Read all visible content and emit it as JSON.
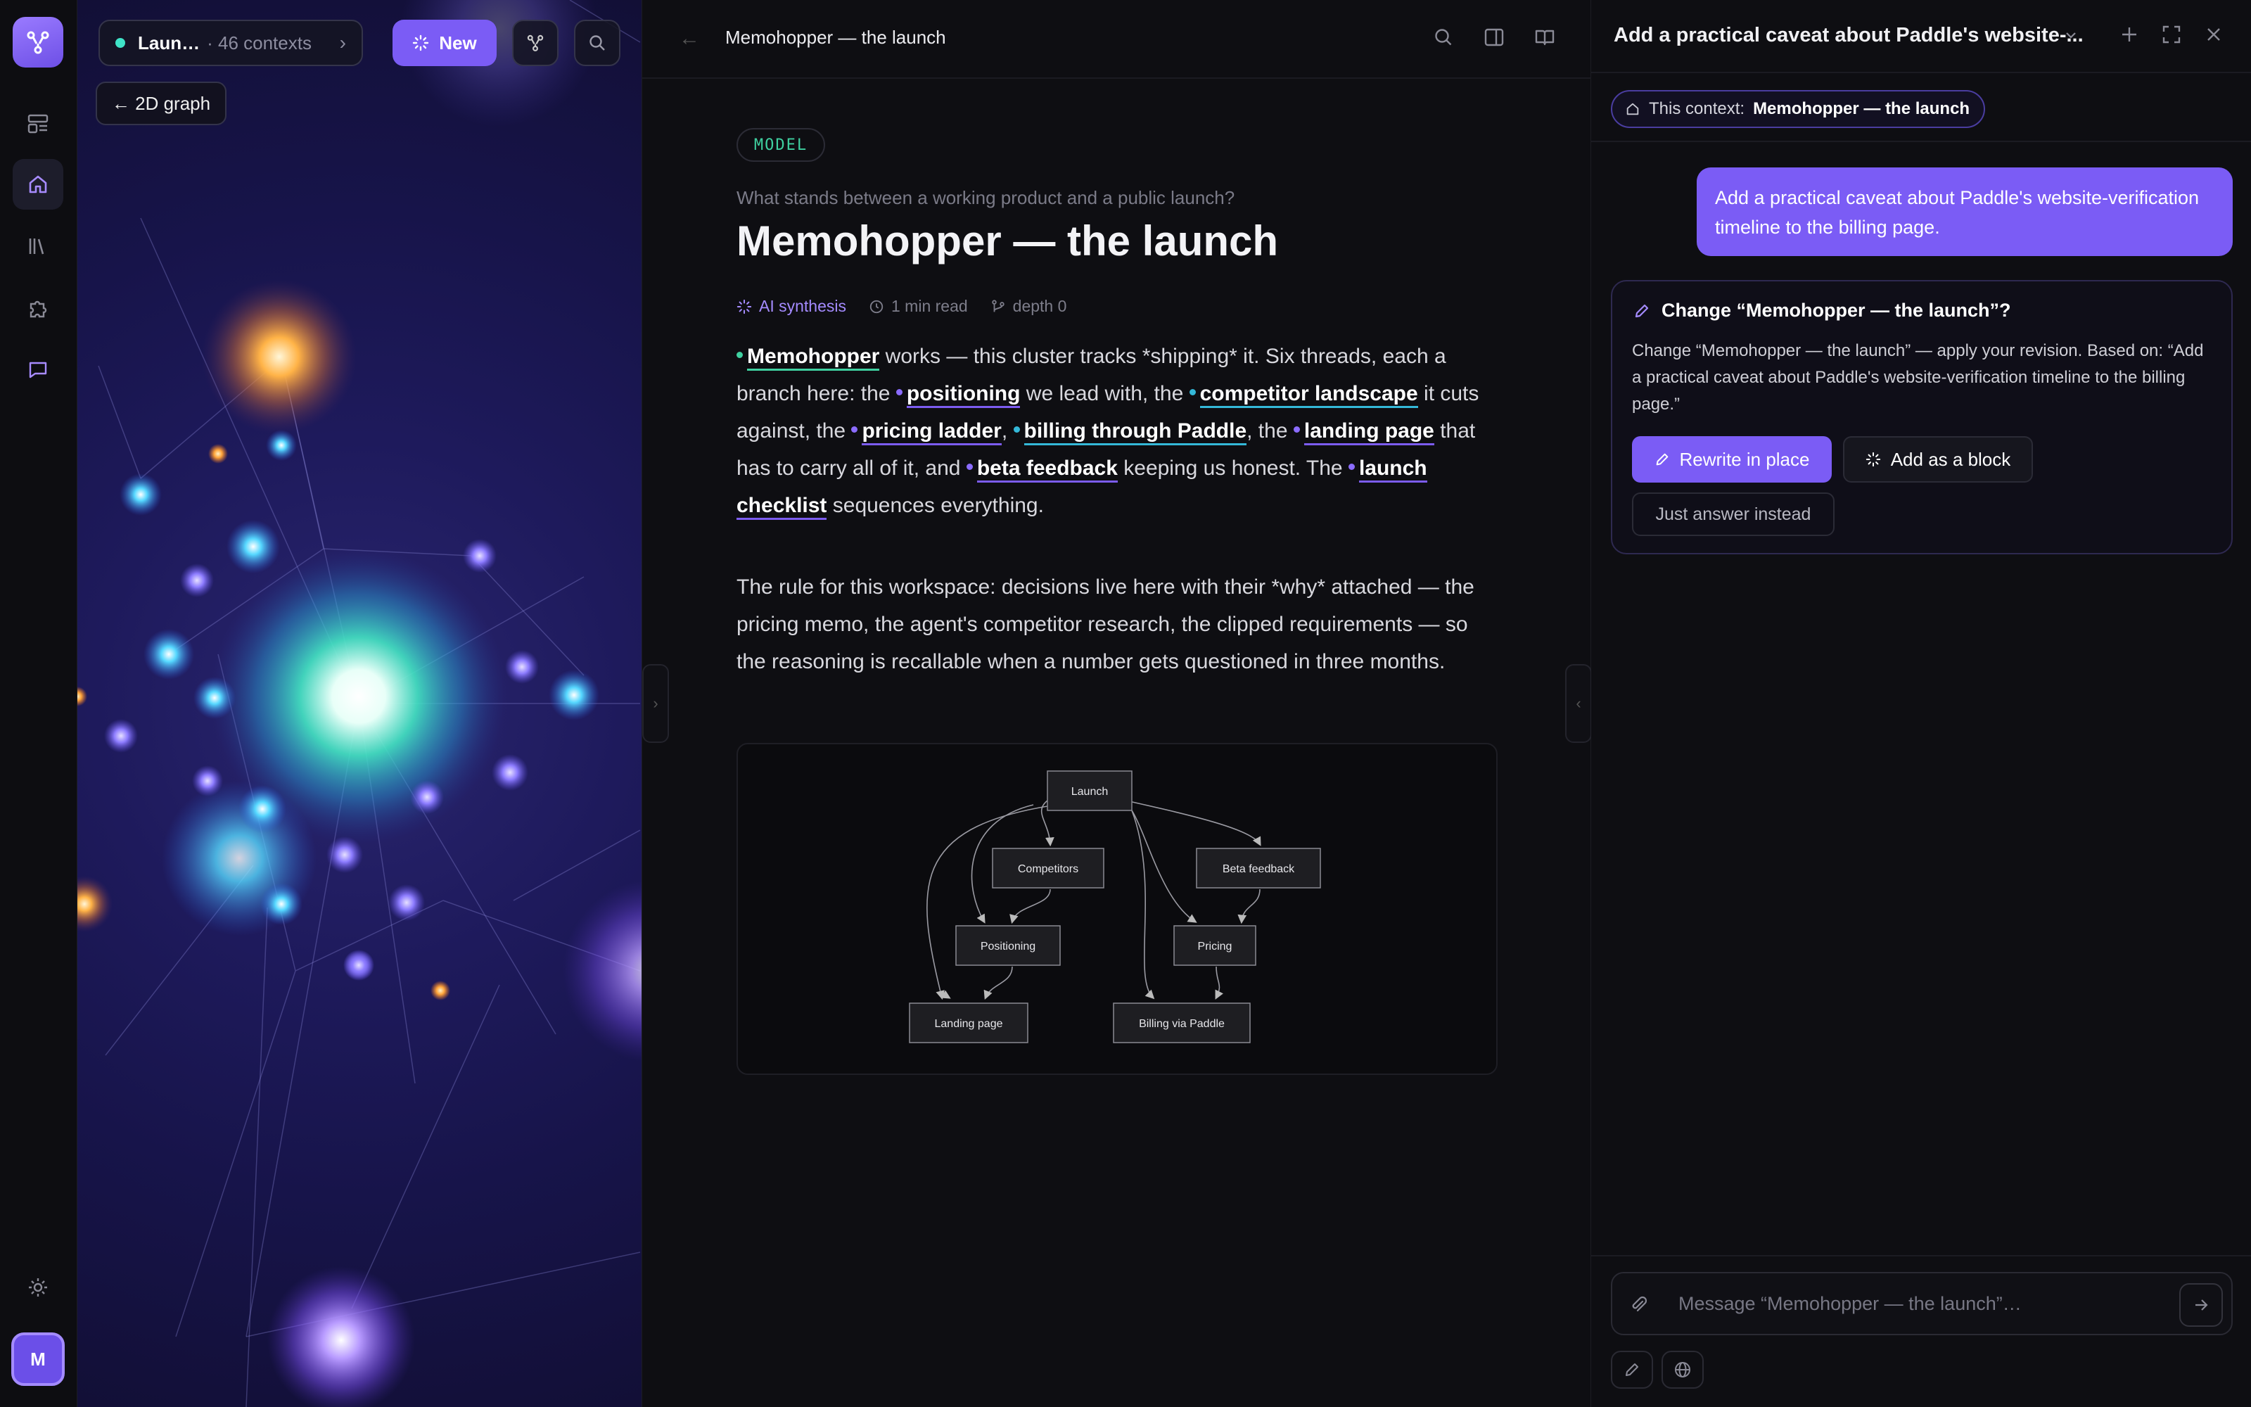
{
  "rail": {
    "avatar_letter": "M"
  },
  "graph": {
    "context_name": "Laun…",
    "context_count": "· 46 contexts",
    "new_label": "New",
    "back_label": "← 2D graph"
  },
  "doc": {
    "top_title": "Memohopper — the launch",
    "badge": "MODEL",
    "subtitle": "What stands between a working product and a public launch?",
    "title": "Memohopper — the launch",
    "meta": {
      "synthesis": "AI synthesis",
      "read": "1 min read",
      "depth": "depth 0"
    },
    "para1": {
      "l_memohopper": "Memohopper",
      "t1": " works — this cluster tracks *shipping* it. Six threads, each a branch here: the ",
      "l_positioning": "positioning",
      "t2": " we lead with, the ",
      "l_competitor": "competitor landscape",
      "t3": " it cuts against, the ",
      "l_pricing": "pricing ladder",
      "t4": ", ",
      "l_billing": "billing through Paddle",
      "t5": ", the ",
      "l_landing": "landing page",
      "t6": " that has to carry all of it, and ",
      "l_beta": "beta feedback",
      "t7": " keeping us honest. The ",
      "l_checklist": "launch checklist",
      "t8": " sequences everything."
    },
    "para2": "The rule for this workspace: decisions live here with their *why* attached — the pricing memo, the agent's competitor research, the clipped requirements — so the reasoning is recallable when a number gets questioned in three months.",
    "diagram": {
      "launch": "Launch",
      "competitors": "Competitors",
      "beta": "Beta feedback",
      "positioning": "Positioning",
      "pricing": "Pricing",
      "landing": "Landing page",
      "billing": "Billing via Paddle"
    }
  },
  "chat": {
    "title": "Add a practical caveat about Paddle's website-...",
    "context_prefix": "This context:",
    "context_name": "Memohopper — the launch",
    "user_message": "Add a practical caveat about Paddle's website-verification timeline to the billing page.",
    "card_title": "Change “Memohopper — the launch”?",
    "card_body": "Change “Memohopper — the launch” — apply your revision. Based on: “Add a practical caveat about Paddle's website-verification timeline to the billing page.”",
    "rewrite_label": "Rewrite in place",
    "block_label": "Add as a block",
    "answer_label": "Just answer instead",
    "composer_placeholder": "Message “Memohopper — the launch”…"
  }
}
